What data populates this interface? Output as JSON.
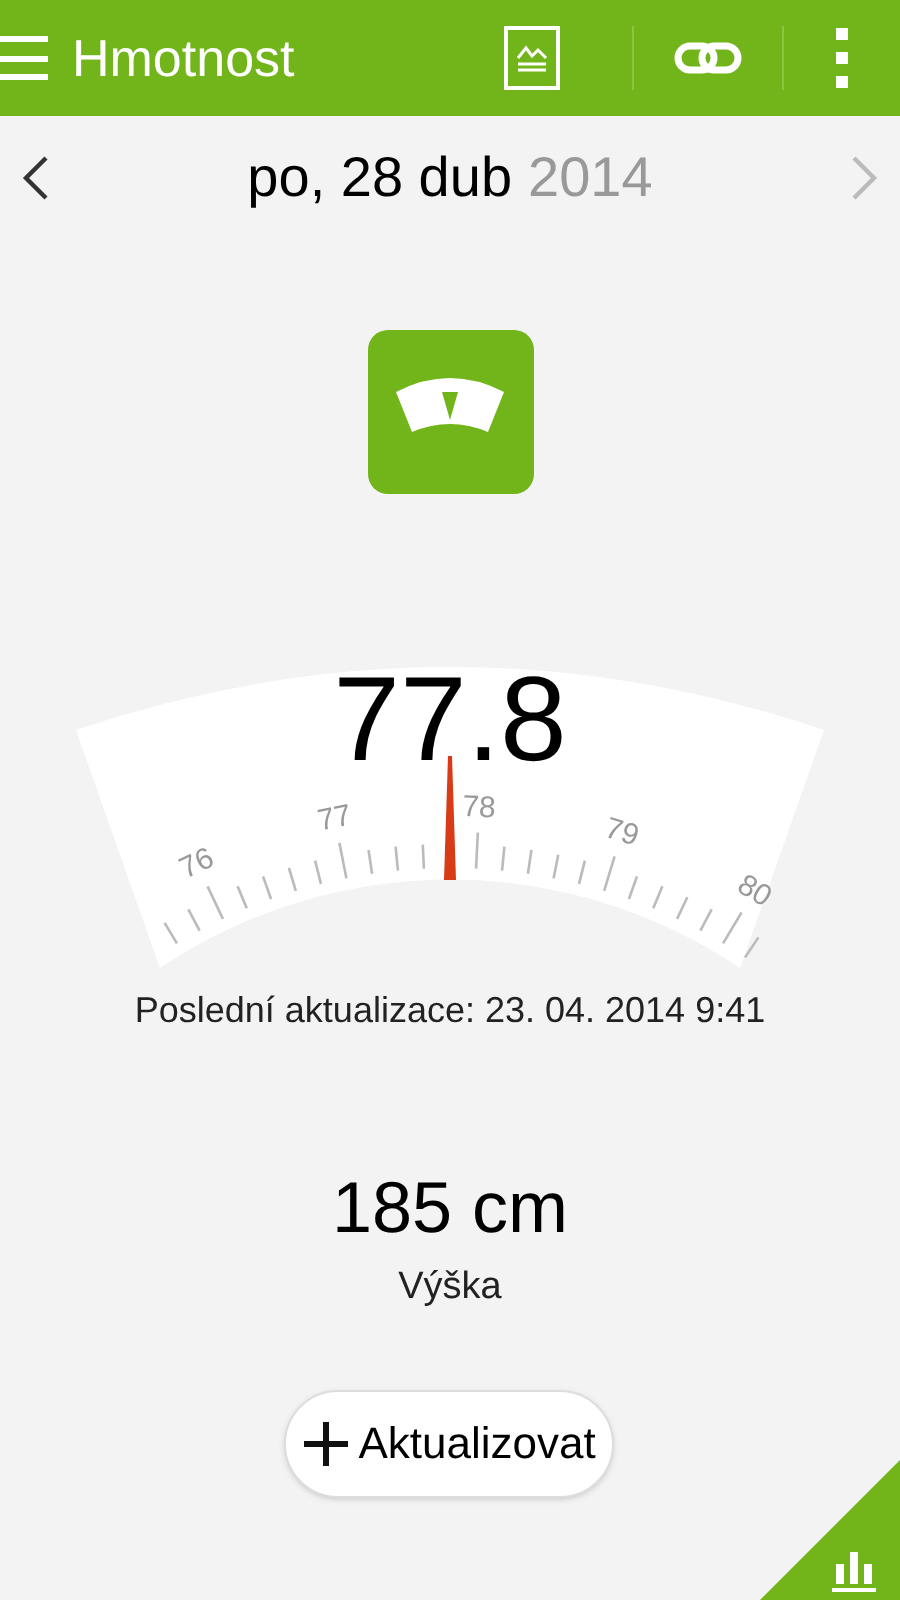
{
  "app_bar": {
    "title": "Hmotnost"
  },
  "date_nav": {
    "date": "po, 28 dub",
    "year": "2014",
    "prev_enabled": true,
    "next_enabled": false
  },
  "gauge": {
    "reading": "77.8",
    "scale_labels": [
      "76",
      "77",
      "78",
      "79",
      "80"
    ]
  },
  "last_update": "Poslední aktualizace: 23. 04. 2014 9:41",
  "height": {
    "value": "185 cm",
    "label": "Výška"
  },
  "update_button": {
    "label": "Aktualizovat"
  }
}
